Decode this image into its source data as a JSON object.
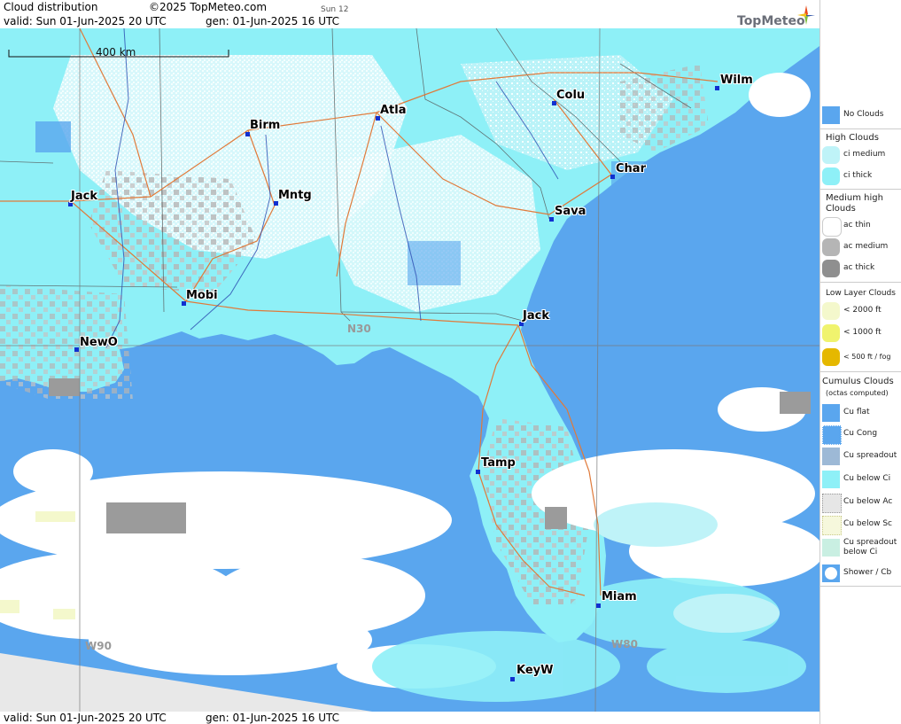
{
  "header": {
    "title": "Cloud distribution",
    "copyright": "©2025 TopMeteo.com",
    "day_tag": "Sun 12",
    "valid_line": "valid:  Sun  01-Jun-2025  20 UTC",
    "gen_line": "gen: 01-Jun-2025 16 UTC",
    "logo": "TopMeteo"
  },
  "footer": {
    "valid_line": "valid:  Sun  01-Jun-2025  20 UTC",
    "gen_line": "gen: 01-Jun-2025 16 UTC"
  },
  "map": {
    "scale_label": "400 km",
    "grid_labels": [
      "N30",
      "W90",
      "W80"
    ],
    "cities": [
      "Birm",
      "Atla",
      "Colu",
      "Wilm",
      "Char",
      "Jack",
      "Mntg",
      "Sava",
      "Mobi",
      "Jack",
      "NewO",
      "Tamp",
      "Miam",
      "KeyW"
    ],
    "colors": {
      "sea": "#5aa6ee",
      "no_clouds": "#5aa6ee",
      "ci_medium": "#bff3f8",
      "ci_thick": "#8ef0f7",
      "ac_thin": "#ffffff",
      "ac_medium": "#b5b5b5",
      "ac_thick": "#8f8f8f",
      "low_2000": "#f4f8cc",
      "low_1000": "#f0f36e",
      "fog": "#e5b800",
      "roads": "#e07a3a",
      "rivers": "#2a4bb0"
    }
  },
  "legend": {
    "no_clouds": "No Clouds",
    "high_head": "High Clouds",
    "ci_medium": "ci medium",
    "ci_thick": "ci thick",
    "medium_head": "Medium high Clouds",
    "ac_thin": "ac thin",
    "ac_medium": "ac medium",
    "ac_thick": "ac thick",
    "low_head": "Low Layer Clouds",
    "low_2000": "< 2000 ft",
    "low_1000": "< 1000 ft",
    "fog": "< 500 ft / fog",
    "cu_head": "Cumulus Clouds",
    "cu_sub": "(octas computed)",
    "cu_flat": "Cu flat",
    "cu_cong": "Cu Cong",
    "cu_spread": "Cu spreadout",
    "cu_below_ci": "Cu below Ci",
    "cu_below_ac": "Cu below Ac",
    "cu_below_sc": "Cu below Sc",
    "cu_spread_ci": "Cu spreadout below Ci",
    "shower": "Shower / Cb"
  }
}
